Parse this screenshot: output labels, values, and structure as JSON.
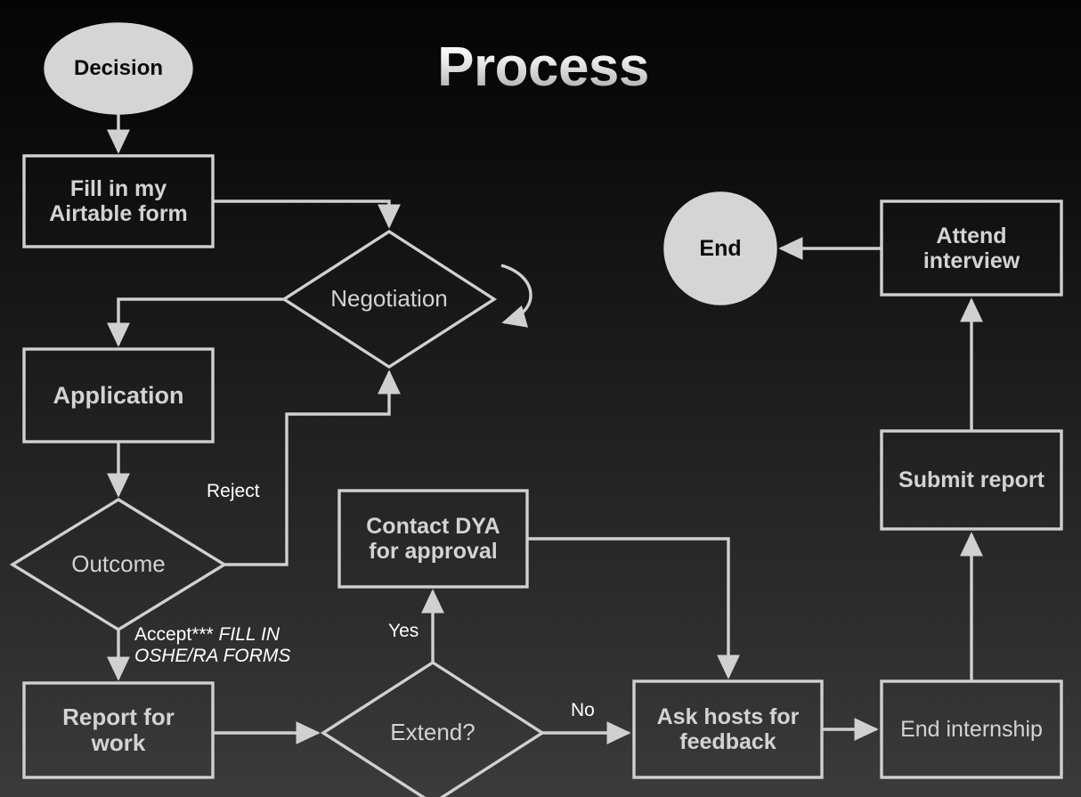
{
  "page": {
    "title": "Process",
    "background_top": "#050505",
    "background_bottom": "#3b3b3b",
    "stroke_color": "#d0d0d0",
    "node_text_color": "#d3d3d3",
    "terminal_fill": "#d5d5d5",
    "terminal_text_color": "#0b0b0b",
    "label_text_color": "#ffffff"
  },
  "nodes": {
    "decision_start": {
      "label": "Decision",
      "shape": "ellipse"
    },
    "fill_form": {
      "label": "Fill in my\nAirtable form",
      "shape": "rect"
    },
    "negotiation": {
      "label": "Negotiation",
      "shape": "diamond"
    },
    "application": {
      "label": "Application",
      "shape": "rect"
    },
    "outcome": {
      "label": "Outcome",
      "shape": "diamond"
    },
    "report_for_work": {
      "label": "Report for\nwork",
      "shape": "rect"
    },
    "extend": {
      "label": "Extend?",
      "shape": "diamond"
    },
    "contact_dya": {
      "label": "Contact DYA\nfor approval",
      "shape": "rect"
    },
    "ask_feedback": {
      "label": "Ask hosts for\nfeedback",
      "shape": "rect"
    },
    "end_internship": {
      "label": "End internship",
      "shape": "rect"
    },
    "submit_report": {
      "label": "Submit report",
      "shape": "rect"
    },
    "attend_interview": {
      "label": "Attend\ninterview",
      "shape": "rect"
    },
    "end_terminal": {
      "label": "End",
      "shape": "circle"
    }
  },
  "edge_labels": {
    "reject": "Reject",
    "accept_plain": "Accept***",
    "accept_italic": " FILL IN OSHE/RA FORMS",
    "yes": "Yes",
    "no": "No"
  }
}
